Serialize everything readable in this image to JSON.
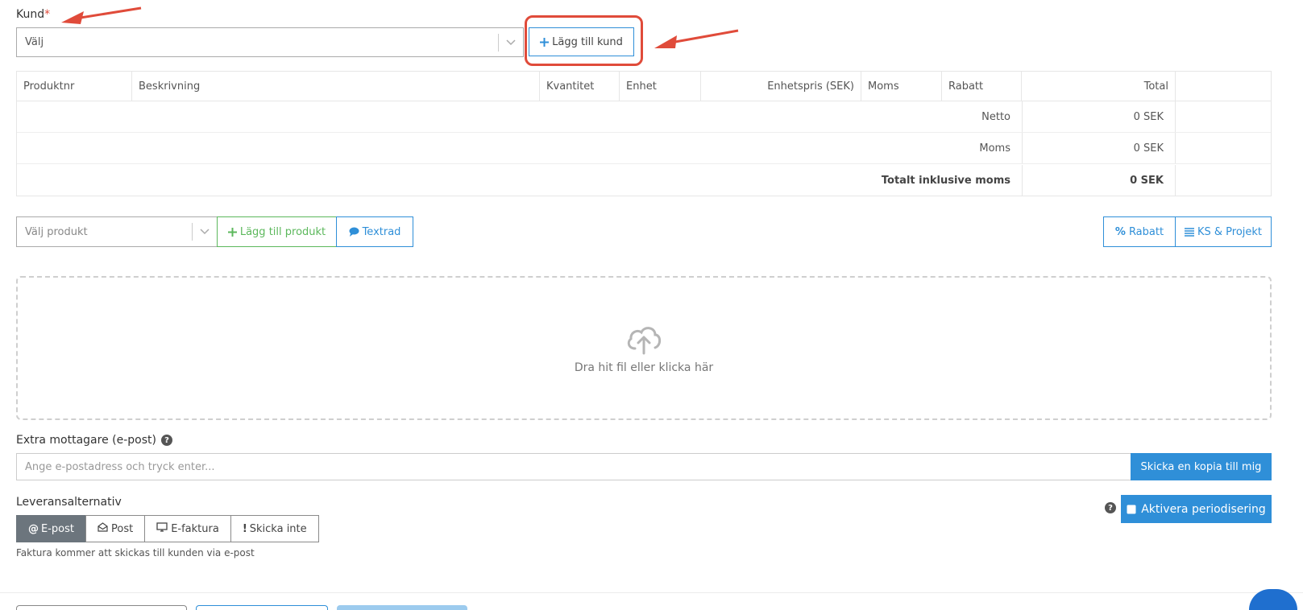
{
  "customer": {
    "label": "Kund",
    "required_mark": "*",
    "select_value": "Välj",
    "add_button": "Lägg till kund"
  },
  "table": {
    "columns": [
      "Produktnr",
      "Beskrivning",
      "Kvantitet",
      "Enhet",
      "Enhetspris (SEK)",
      "Moms",
      "Rabatt",
      "Total"
    ],
    "summary": [
      {
        "label": "Netto",
        "value": "0 SEK"
      },
      {
        "label": "Moms",
        "value": "0 SEK"
      },
      {
        "label": "Totalt inklusive moms",
        "value": "0 SEK"
      }
    ]
  },
  "products": {
    "select_placeholder": "Välj produkt",
    "add_button": "Lägg till produkt",
    "text_row_button": "Textrad",
    "discount_button": "Rabatt",
    "ks_button": "KS & Projekt"
  },
  "upload": {
    "text": "Dra hit fil eller klicka här"
  },
  "extra_recipients": {
    "label": "Extra mottagare (e-post)",
    "help": "?",
    "placeholder": "Ange e-postadress och tryck enter...",
    "copy_button": "Skicka en kopia till mig"
  },
  "delivery": {
    "label": "Leveransalternativ",
    "options": [
      "E-post",
      "Post",
      "E-faktura",
      "Skicka inte"
    ],
    "selected": "E-post",
    "hint": "Faktura kommer att skickas till kunden via e-post"
  },
  "periodization": {
    "help": "?",
    "button": "Aktivera periodisering"
  },
  "colors": {
    "accent_blue": "#2f8fd8",
    "green": "#5cb85c",
    "annotation_red": "#e04b3a",
    "active_segment": "#6c757d"
  }
}
